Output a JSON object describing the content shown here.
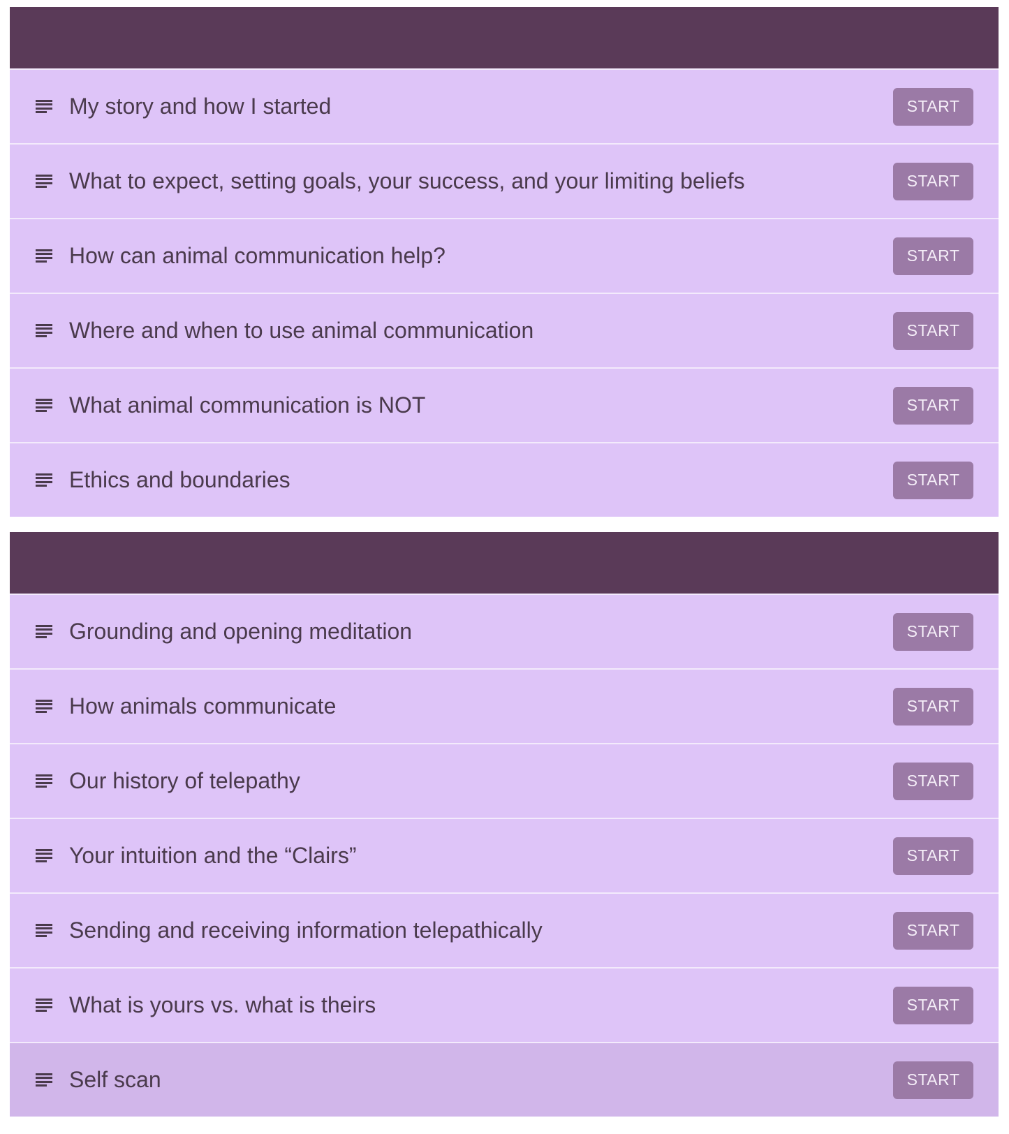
{
  "sections": [
    {
      "lessons": [
        {
          "title": "My story and how I started",
          "button": "START"
        },
        {
          "title": "What to expect, setting goals, your success, and your limiting beliefs",
          "button": "START"
        },
        {
          "title": "How can animal communication help?",
          "button": "START"
        },
        {
          "title": "Where and when to use animal communication",
          "button": "START"
        },
        {
          "title": "What animal communication is NOT",
          "button": "START"
        },
        {
          "title": "Ethics and boundaries",
          "button": "START"
        }
      ]
    },
    {
      "lessons": [
        {
          "title": "Grounding and opening meditation",
          "button": "START"
        },
        {
          "title": "How animals communicate",
          "button": "START"
        },
        {
          "title": "Our history of telepathy",
          "button": "START"
        },
        {
          "title": "Your intuition and the “Clairs”",
          "button": "START"
        },
        {
          "title": "Sending and receiving information telepathically",
          "button": "START"
        },
        {
          "title": "What is yours vs. what is theirs",
          "button": "START"
        },
        {
          "title": "Self scan",
          "button": "START",
          "highlighted": true
        }
      ]
    }
  ],
  "colors": {
    "section_header": "#5a3a58",
    "row_background": "#dec4f8",
    "row_highlight": "#d1b6ea",
    "button_background": "#9b7aa6",
    "text": "#4a3a4c"
  },
  "icons": {
    "lesson": "text-lines-icon"
  }
}
